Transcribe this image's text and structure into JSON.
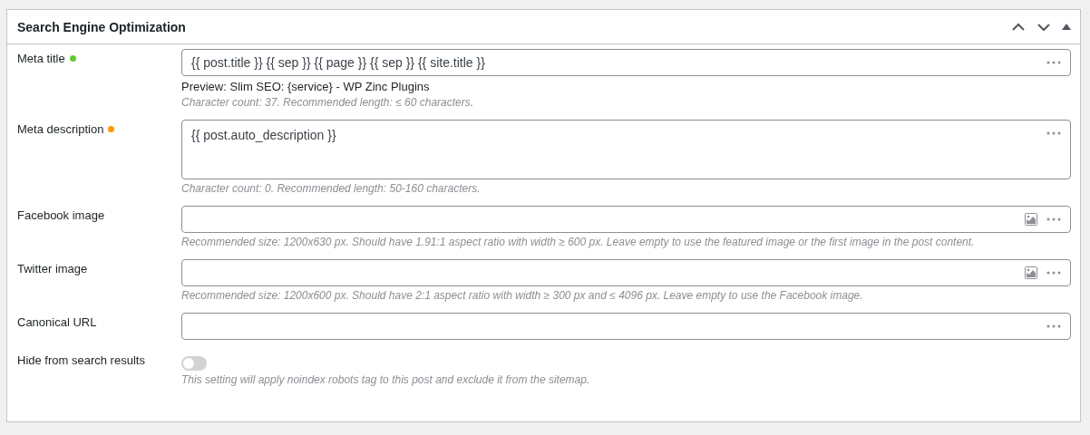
{
  "panel": {
    "title": "Search Engine Optimization"
  },
  "fields": [
    {
      "label": "Meta title",
      "kind": "text",
      "color": "#64c931",
      "value": "{{ post.title }} {{ sep }} {{ page }} {{ sep }} {{ site.title }}",
      "preview": "Preview: Slim SEO: {service} - WP Zinc Plugins",
      "help": "Character count: 37. Recommended length: ≤ 60 characters."
    },
    {
      "label": "Meta description",
      "kind": "textarea",
      "color": "#ff9a00",
      "value": "{{ post.auto_description }}",
      "help": "Character count: 0. Recommended length: 50-160 characters."
    },
    {
      "label": "Facebook image",
      "kind": "image",
      "help": "Recommended size: 1200x630 px. Should have 1.91:1 aspect ratio with width ≥ 600 px. Leave empty to use the featured image or the first image in the post content."
    },
    {
      "label": "Twitter image",
      "kind": "image",
      "help": "Recommended size: 1200x600 px. Should have 2:1 aspect ratio with width ≥ 300 px and ≤ 4096 px. Leave empty to use the Facebook image."
    },
    {
      "label": "Canonical URL",
      "kind": "text"
    },
    {
      "label": "Hide from search results",
      "kind": "toggle",
      "on": false,
      "help": "This setting will apply noindex robots tag to this post and exclude it from the sitemap."
    }
  ]
}
